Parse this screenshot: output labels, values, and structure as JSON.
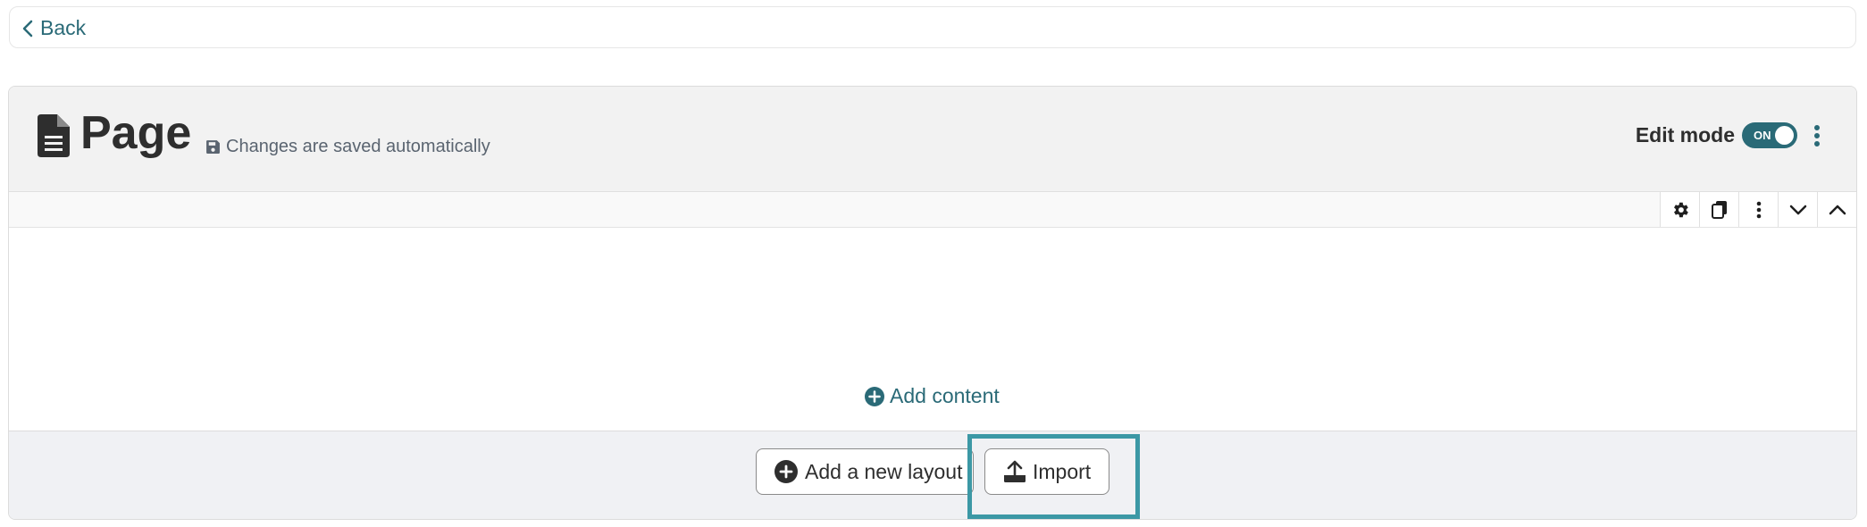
{
  "nav": {
    "back_label": "Back"
  },
  "header": {
    "title": "Page",
    "save_note": "Changes are saved automatically",
    "edit_mode_label": "Edit mode",
    "toggle_state": "ON"
  },
  "content": {
    "add_content_label": "Add content"
  },
  "footer": {
    "add_layout_label": "Add a new layout",
    "import_label": "Import"
  },
  "colors": {
    "accent": "#2a6a77",
    "highlight": "#3c98a5",
    "header_bg": "#f2f2f2",
    "footer_bg": "#f0f1f4"
  }
}
